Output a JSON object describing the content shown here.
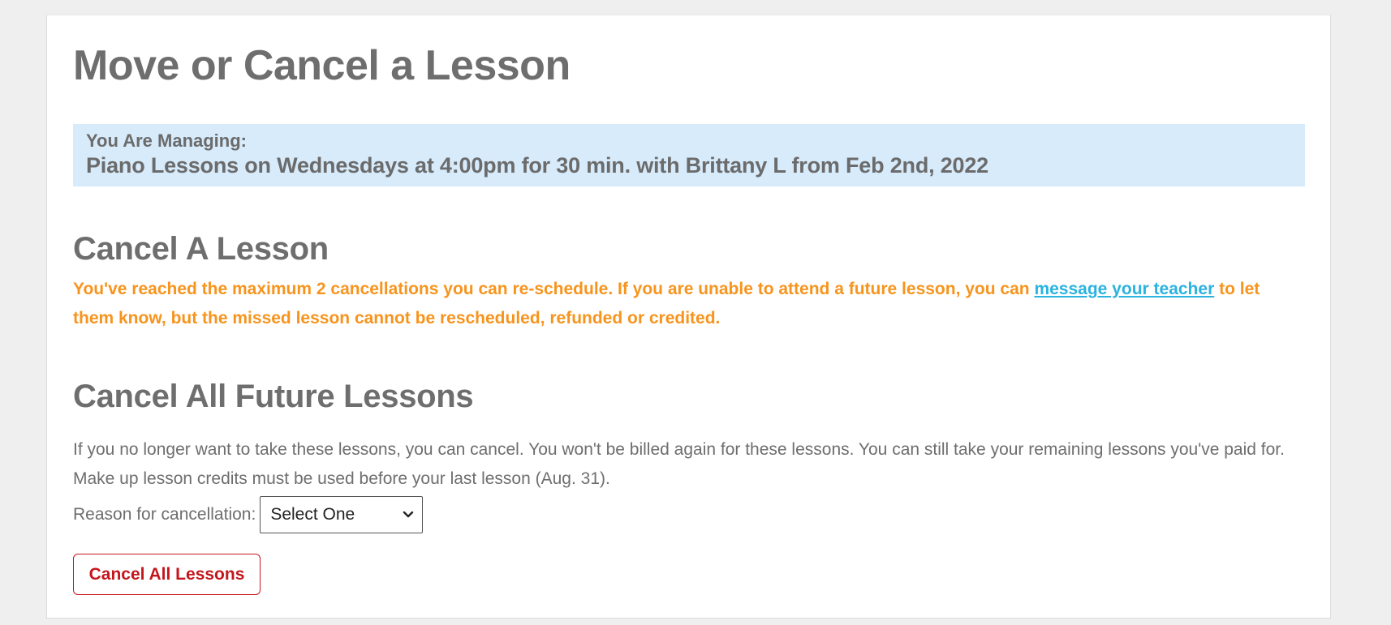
{
  "page": {
    "title": "Move or Cancel a Lesson"
  },
  "managing": {
    "label": "You Are Managing:",
    "value": "Piano Lessons on Wednesdays at 4:00pm for 30 min. with Brittany L from Feb 2nd, 2022"
  },
  "cancel_lesson": {
    "title": "Cancel A Lesson",
    "warning_before_link": "You've reached the maximum 2 cancellations you can re-schedule. If you are unable to attend a future lesson, you can ",
    "link_text": "message your teacher",
    "warning_after_link": " to let them know, but the missed lesson cannot be rescheduled, refunded or credited."
  },
  "cancel_future": {
    "title": "Cancel All Future Lessons",
    "description": "If you no longer want to take these lessons, you can cancel. You won't be billed again for these lessons. You can still take your remaining lessons you've paid for. Make up lesson credits must be used before your last lesson (Aug. 31).",
    "reason_label": "Reason for cancellation:",
    "reason_selected": "Select One",
    "button_label": "Cancel All Lessons"
  },
  "colors": {
    "page_bg": "#efefef",
    "managing_bg": "#d7ebfb",
    "warning": "#f7941d",
    "link": "#2bb3df",
    "danger": "#c4161c",
    "heading": "#6e6e6e"
  },
  "icons": {
    "select_chevron": "chevron-down-icon"
  }
}
